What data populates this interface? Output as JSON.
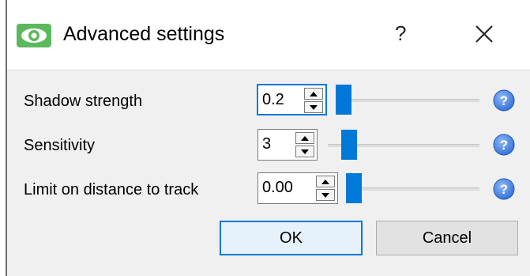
{
  "window": {
    "title": "Advanced settings",
    "help_label": "?",
    "app_icon": "eye-icon",
    "close_icon": "close-icon"
  },
  "settings": [
    {
      "label": "Shadow strength",
      "value": "0.2",
      "slider_fraction": 0.0,
      "help_icon": "help-icon"
    },
    {
      "label": "Sensitivity",
      "value": "3",
      "slider_fraction": 0.1,
      "help_icon": "help-icon"
    },
    {
      "label": "Limit on distance to track",
      "value": "0.00",
      "slider_fraction": 0.0,
      "help_icon": "help-icon"
    }
  ],
  "buttons": {
    "ok": "OK",
    "cancel": "Cancel"
  },
  "colors": {
    "accent": "#0078d7",
    "app_icon_green": "#5bb85d",
    "help_blue": "#3c7fe0"
  }
}
